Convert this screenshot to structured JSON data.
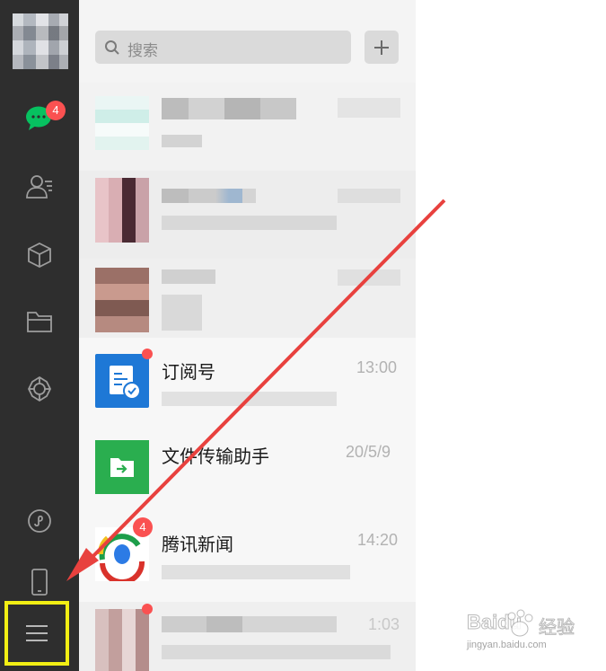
{
  "search": {
    "placeholder": "搜索"
  },
  "sidebar": {
    "chat_badge": "4"
  },
  "chats": [
    {
      "name": "",
      "time": "",
      "blurred": true
    },
    {
      "name": "",
      "time": "",
      "blurred": true
    },
    {
      "name": "",
      "time": "",
      "blurred": true
    },
    {
      "name": "订阅号",
      "time": "13:00",
      "blurred": false,
      "unread_dot": true
    },
    {
      "name": "文件传输助手",
      "time": "20/5/9",
      "blurred": false
    },
    {
      "name": "腾讯新闻",
      "time": "14:20",
      "blurred": false,
      "badge": "4"
    },
    {
      "name": "",
      "time": "1:03",
      "blurred": true,
      "unread_dot": true
    }
  ],
  "watermark": {
    "brand": "Baidu",
    "brand_cn": "经验",
    "url": "jingyan.baidu.com"
  },
  "colors": {
    "sidebar": "#2e2e2e",
    "accent_green": "#07c160",
    "badge_red": "#fa5151",
    "highlight": "#f2ee14",
    "arrow": "#e8413e"
  }
}
